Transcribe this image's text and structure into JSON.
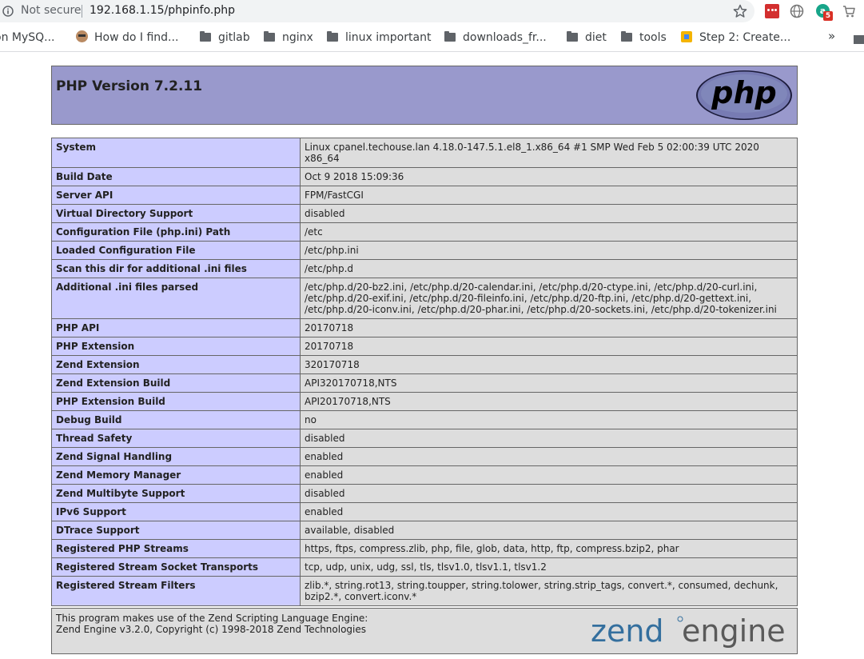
{
  "browser": {
    "security_label": "Not secure",
    "url": "192.168.1.15/phpinfo.php",
    "ext_badge": "5",
    "ext_green_letter": "a",
    "bookmarks": [
      {
        "label": "on MySQ...",
        "icon": "none"
      },
      {
        "label": "How do I find...",
        "icon": "avatar"
      },
      {
        "label": "gitlab",
        "icon": "folder"
      },
      {
        "label": "nginx",
        "icon": "folder"
      },
      {
        "label": "linux important",
        "icon": "folder"
      },
      {
        "label": "downloads_fr...",
        "icon": "folder"
      },
      {
        "label": "diet",
        "icon": "folder"
      },
      {
        "label": "tools",
        "icon": "folder"
      },
      {
        "label": "Step 2: Create...",
        "icon": "cube"
      }
    ],
    "more_label": "»"
  },
  "header": {
    "title": "PHP Version 7.2.11",
    "logo_text": "php"
  },
  "rows": [
    {
      "k": "System",
      "v": "Linux cpanel.techouse.lan 4.18.0-147.5.1.el8_1.x86_64 #1 SMP Wed Feb 5 02:00:39 UTC 2020 x86_64"
    },
    {
      "k": "Build Date",
      "v": "Oct 9 2018 15:09:36"
    },
    {
      "k": "Server API",
      "v": "FPM/FastCGI"
    },
    {
      "k": "Virtual Directory Support",
      "v": "disabled"
    },
    {
      "k": "Configuration File (php.ini) Path",
      "v": "/etc"
    },
    {
      "k": "Loaded Configuration File",
      "v": "/etc/php.ini"
    },
    {
      "k": "Scan this dir for additional .ini files",
      "v": "/etc/php.d"
    },
    {
      "k": "Additional .ini files parsed",
      "v": "/etc/php.d/20-bz2.ini, /etc/php.d/20-calendar.ini, /etc/php.d/20-ctype.ini, /etc/php.d/20-curl.ini, /etc/php.d/20-exif.ini, /etc/php.d/20-fileinfo.ini, /etc/php.d/20-ftp.ini, /etc/php.d/20-gettext.ini, /etc/php.d/20-iconv.ini, /etc/php.d/20-phar.ini, /etc/php.d/20-sockets.ini, /etc/php.d/20-tokenizer.ini"
    },
    {
      "k": "PHP API",
      "v": "20170718"
    },
    {
      "k": "PHP Extension",
      "v": "20170718"
    },
    {
      "k": "Zend Extension",
      "v": "320170718"
    },
    {
      "k": "Zend Extension Build",
      "v": "API320170718,NTS"
    },
    {
      "k": "PHP Extension Build",
      "v": "API20170718,NTS"
    },
    {
      "k": "Debug Build",
      "v": "no"
    },
    {
      "k": "Thread Safety",
      "v": "disabled"
    },
    {
      "k": "Zend Signal Handling",
      "v": "enabled"
    },
    {
      "k": "Zend Memory Manager",
      "v": "enabled"
    },
    {
      "k": "Zend Multibyte Support",
      "v": "disabled"
    },
    {
      "k": "IPv6 Support",
      "v": "enabled"
    },
    {
      "k": "DTrace Support",
      "v": "available, disabled"
    },
    {
      "k": "Registered PHP Streams",
      "v": "https, ftps, compress.zlib, php, file, glob, data, http, ftp, compress.bzip2, phar"
    },
    {
      "k": "Registered Stream Socket Transports",
      "v": "tcp, udp, unix, udg, ssl, tls, tlsv1.0, tlsv1.1, tlsv1.2"
    },
    {
      "k": "Registered Stream Filters",
      "v": "zlib.*, string.rot13, string.toupper, string.tolower, string.strip_tags, convert.*, consumed, dechunk, bzip2.*, convert.iconv.*"
    }
  ],
  "zend": {
    "line1": "This program makes use of the Zend Scripting Language Engine:",
    "line2": "Zend Engine v3.2.0, Copyright (c) 1998-2018 Zend Technologies",
    "logo_left": "zend",
    "logo_right": "engine"
  },
  "colors": {
    "header_bg": "#9999cc",
    "key_bg": "#ccccff",
    "value_bg": "#dddddd",
    "border": "#666666",
    "zend_blue": "#346f9e",
    "zend_gray": "#5a5a5a"
  }
}
